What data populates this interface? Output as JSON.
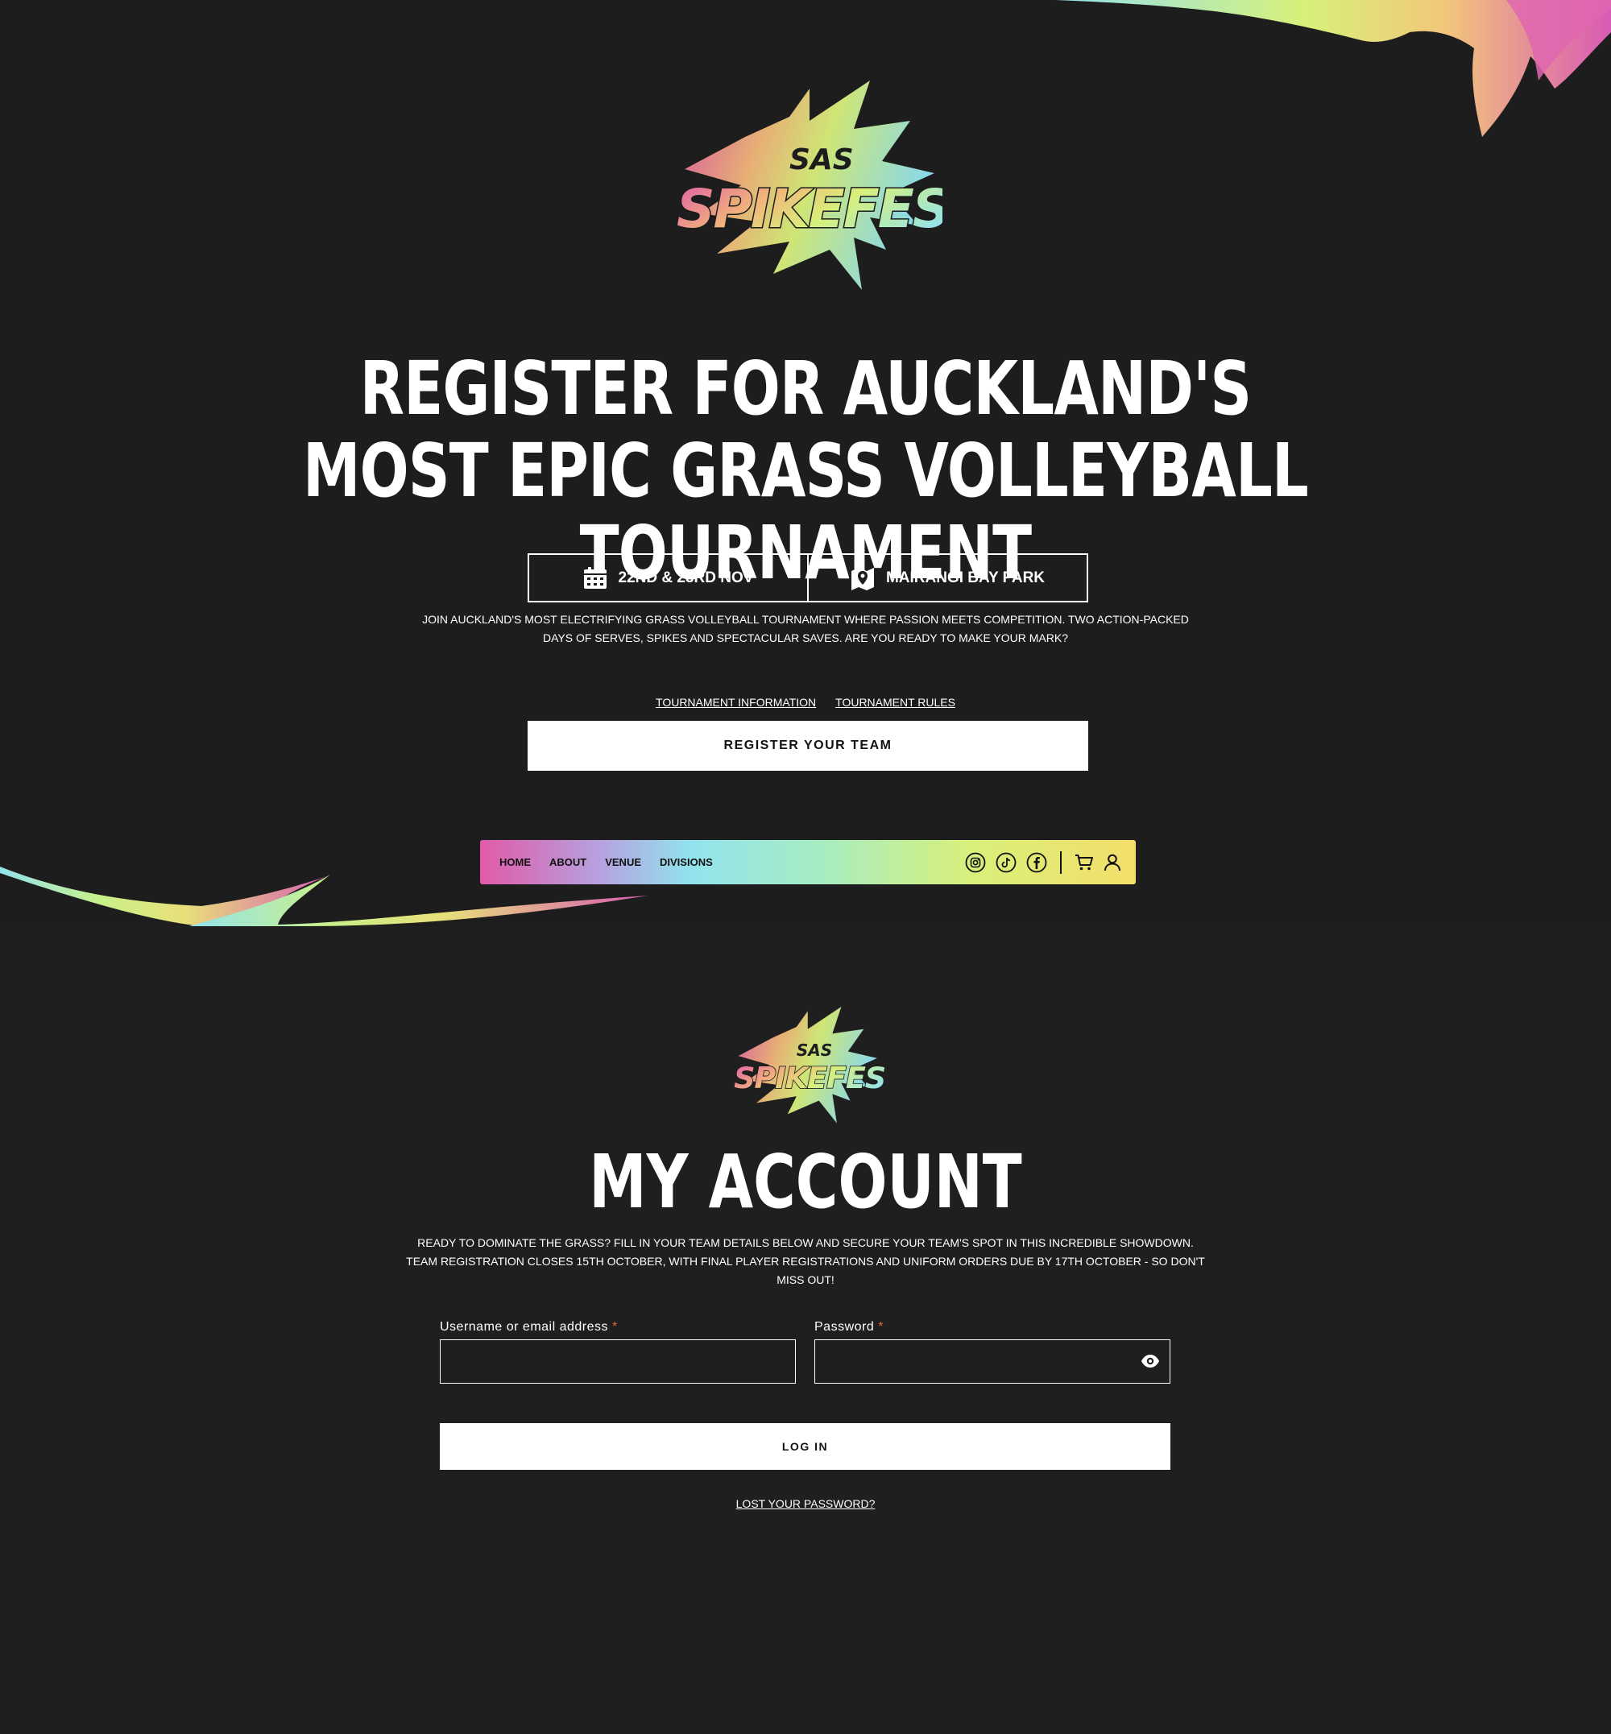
{
  "logo": {
    "top_text": "SAS",
    "main_text": "SPIKEFEST"
  },
  "hero": {
    "title": "Register for Auckland's most epic grass volleyball tournament",
    "date": "22ND & 23RD NOV",
    "venue": "MAIRANGI BAY PARK",
    "intro": "Join Auckland's most electrifying grass volleyball tournament where passion meets competition. Two action-packed days of serves, spikes and spectacular saves. Are you ready to make your mark?",
    "links": [
      "TOURNAMENT INFORMATION",
      "TOURNAMENT RULES"
    ],
    "register_label": "REGISTER YOUR TEAM"
  },
  "nav": {
    "items": [
      "HOME",
      "ABOUT",
      "VENUE",
      "DIVISIONS"
    ],
    "icons": [
      "instagram-icon",
      "tiktok-icon",
      "facebook-icon",
      "cart-icon",
      "user-icon"
    ]
  },
  "account": {
    "title": "My Account",
    "intro": "Ready to dominate the grass? Fill in your team details below and secure your team's spot in this incredible showdown. Team registration closes 15th October, with final player registrations and uniform orders due by 17th October - so don't miss out!",
    "username_label": "Username or email address",
    "password_label": "Password",
    "required_mark": "*",
    "username_value": "",
    "password_value": "",
    "login_label": "LOG IN",
    "lost_password": "Lost your password?"
  },
  "colors": {
    "background": "#1f1f1f",
    "pink": "#e15aa8",
    "cyan": "#92e3ee",
    "lime": "#d8f07a",
    "required": "#e06a3a"
  }
}
